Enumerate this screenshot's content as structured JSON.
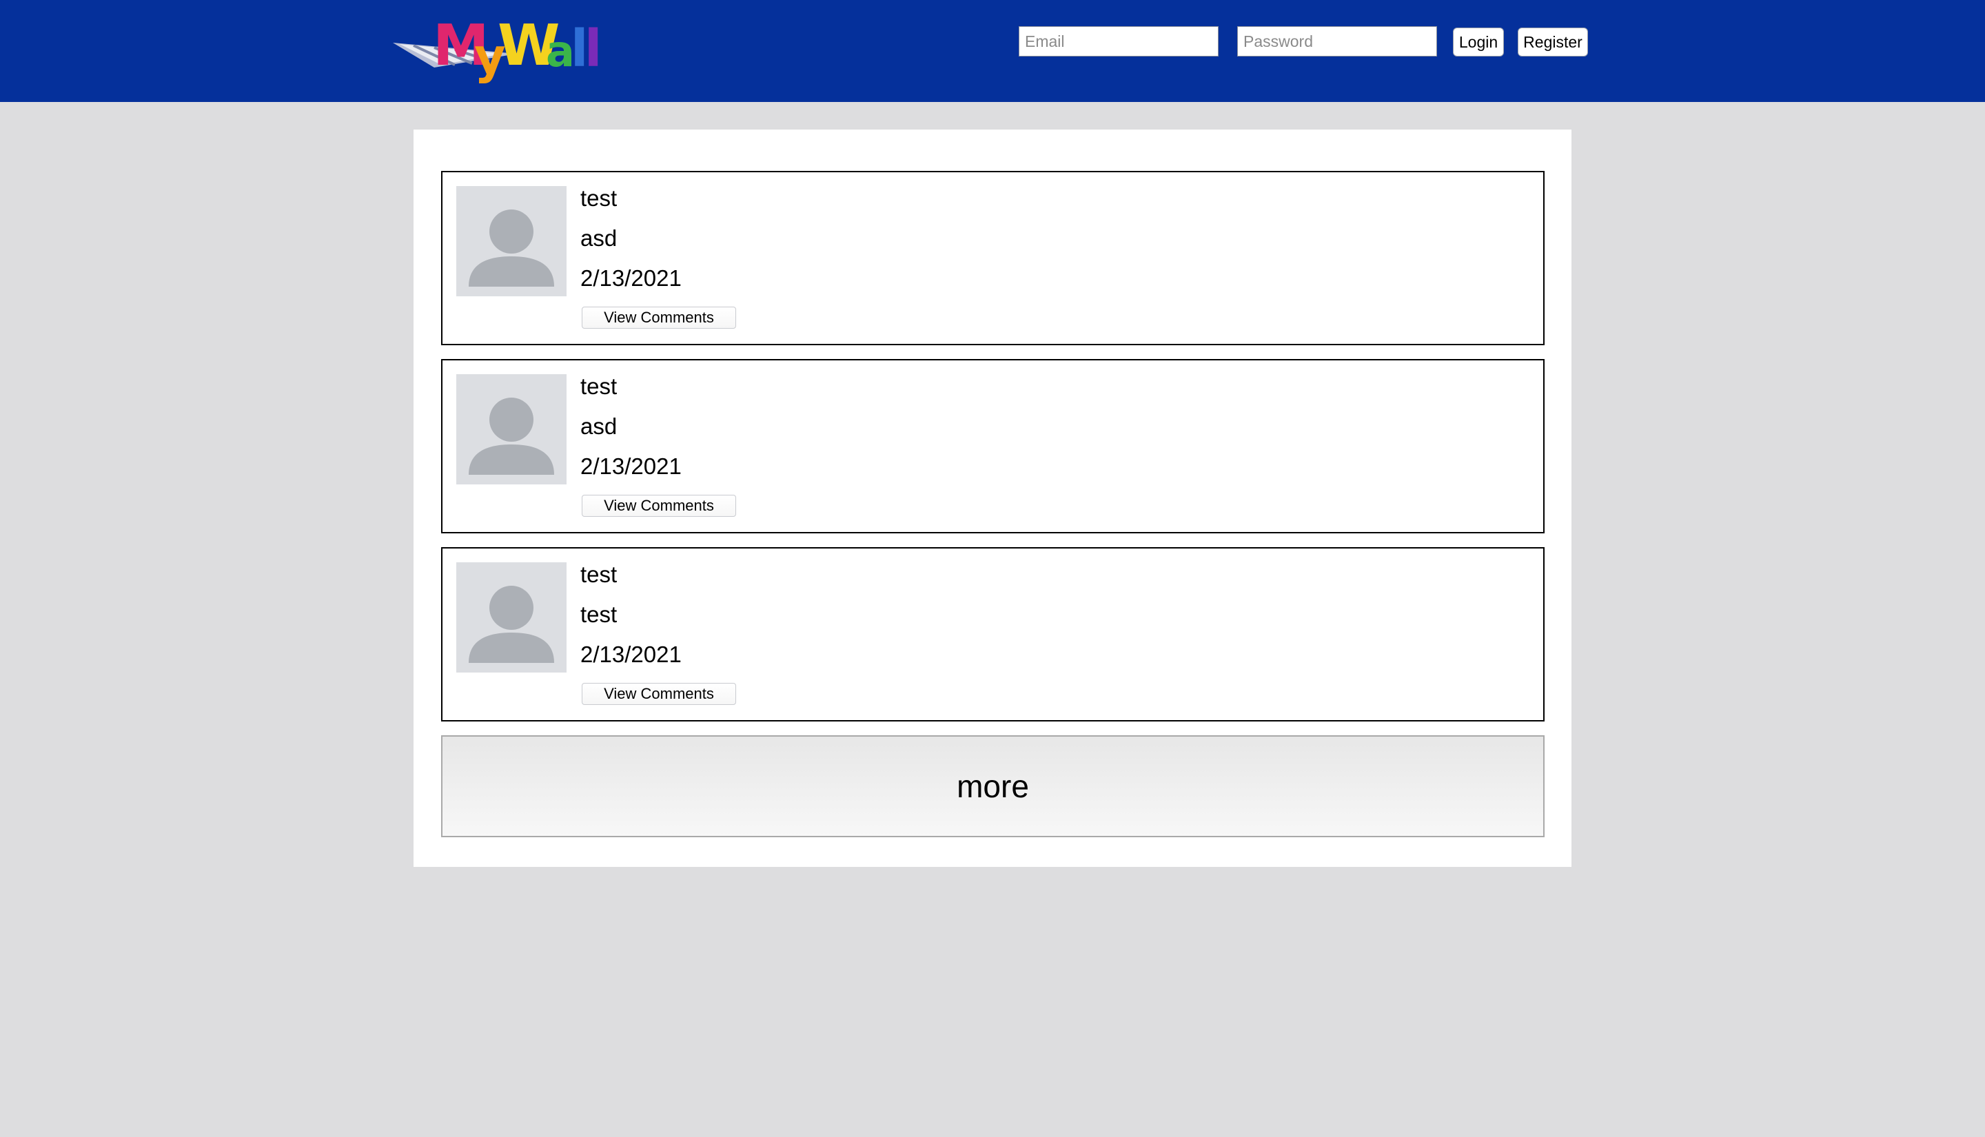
{
  "header": {
    "logo_text": "MyWall",
    "email_placeholder": "Email",
    "password_placeholder": "Password",
    "login_label": "Login",
    "register_label": "Register",
    "colors": {
      "topbar": "#05309b",
      "page_background": "#dddddf"
    }
  },
  "posts": [
    {
      "title": "test",
      "body": "asd",
      "date": "2/13/2021",
      "comments_label": "View Comments",
      "avatar_icon": "person-placeholder-icon"
    },
    {
      "title": "test",
      "body": "asd",
      "date": "2/13/2021",
      "comments_label": "View Comments",
      "avatar_icon": "person-placeholder-icon"
    },
    {
      "title": "test",
      "body": "test",
      "date": "2/13/2021",
      "comments_label": "View Comments",
      "avatar_icon": "person-placeholder-icon"
    }
  ],
  "more_label": "more"
}
